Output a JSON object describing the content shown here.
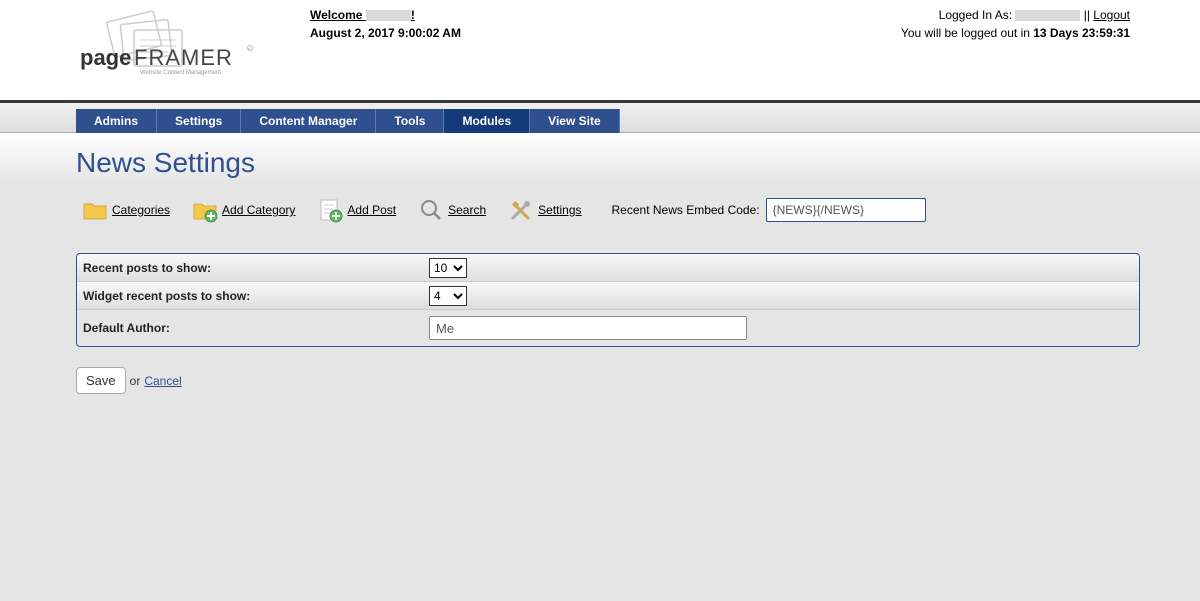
{
  "header": {
    "welcome_prefix": "Welcome ",
    "welcome_suffix": "!",
    "date": "August 2, 2017 9:00:02 AM",
    "logged_in_prefix": "Logged In As: ",
    "separator": " || ",
    "logout": "Logout",
    "logout_warning_prefix": "You will be logged out in ",
    "countdown": "13 Days 23:59:31"
  },
  "nav": {
    "items": [
      "Admins",
      "Settings",
      "Content Manager",
      "Tools",
      "Modules",
      "View Site"
    ],
    "active_index": 4
  },
  "page": {
    "title": "News Settings"
  },
  "toolbar": {
    "categories": "Categories",
    "add_category": "Add Category",
    "add_post": "Add Post",
    "search": "Search",
    "settings": "Settings",
    "embed_label": "Recent News Embed Code:",
    "embed_value": "{NEWS}{/NEWS}"
  },
  "settings": {
    "recent_posts_label": "Recent posts to show:",
    "recent_posts_value": "10",
    "widget_posts_label": "Widget recent posts to show:",
    "widget_posts_value": "4",
    "default_author_label": "Default Author:",
    "default_author_value": "Me"
  },
  "actions": {
    "save": "Save",
    "or": " or ",
    "cancel": "Cancel"
  }
}
